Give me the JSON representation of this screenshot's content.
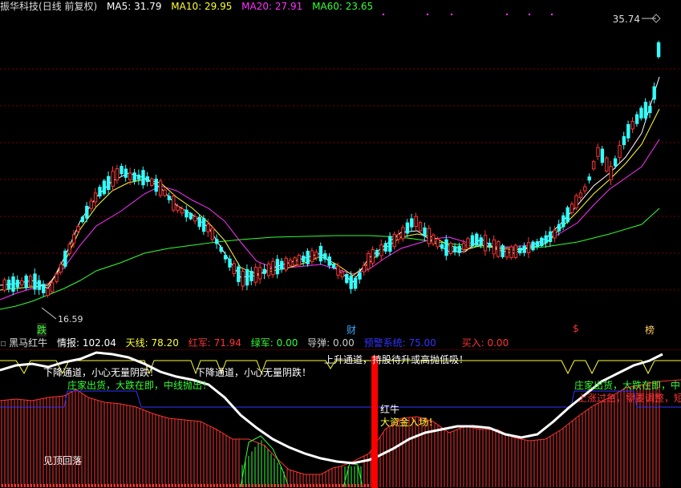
{
  "main": {
    "stock_title": "振华科技",
    "period": "(日线 前复权)",
    "ma": [
      {
        "label": "MA5: ",
        "value": "31.79",
        "color": "#ffffff"
      },
      {
        "label": "MA10: ",
        "value": "29.95",
        "color": "#ffff33"
      },
      {
        "label": "MA20: ",
        "value": "27.91",
        "color": "#ff33ff"
      },
      {
        "label": "MA60: ",
        "value": "23.65",
        "color": "#33ff33"
      }
    ],
    "high_label": "35.74",
    "low_label": "16.59",
    "markers": {
      "die": "跌",
      "cai": "财",
      "s": "$",
      "bang": "榜"
    }
  },
  "indicator": {
    "name": "黑马红牛",
    "fields": [
      {
        "label": "情报: ",
        "value": "102.04",
        "color": "#ffffff"
      },
      {
        "label": "天线: ",
        "value": "78.20",
        "color": "#ffff33"
      },
      {
        "label": "红军: ",
        "value": "71.94",
        "color": "#ff3333"
      },
      {
        "label": "绿军: ",
        "value": "0.00",
        "color": "#33ff33"
      },
      {
        "label": "导弹: ",
        "value": "0.00",
        "color": "#cccccc"
      },
      {
        "label": "预警系统: ",
        "value": "75.00",
        "color": "#3333ff"
      },
      {
        "label": "买入: ",
        "value": "0.00",
        "color": "#ff3333"
      }
    ],
    "annotations": {
      "down1": "下降通道，小心无量阴跌！",
      "down2": "下降通道，小心无量阴跌！",
      "up": "上升通道，持股待升或高抛低吸！",
      "ship1": "庄家出货，大跌在即，中线抛出！",
      "ship2": "庄家出货，大跌在即，中",
      "peak": "见顶回落",
      "red_bull": "红牛",
      "big_money": "大资金入场！",
      "rise_fast": "上涨过急，需要调整，短"
    }
  },
  "colors": {
    "up": "#ff3333",
    "down": "#33ffff",
    "ma5": "#ffffff",
    "ma10": "#ffff33",
    "ma20": "#ff33ff",
    "ma60": "#33ff33",
    "grid": "#800000"
  }
}
